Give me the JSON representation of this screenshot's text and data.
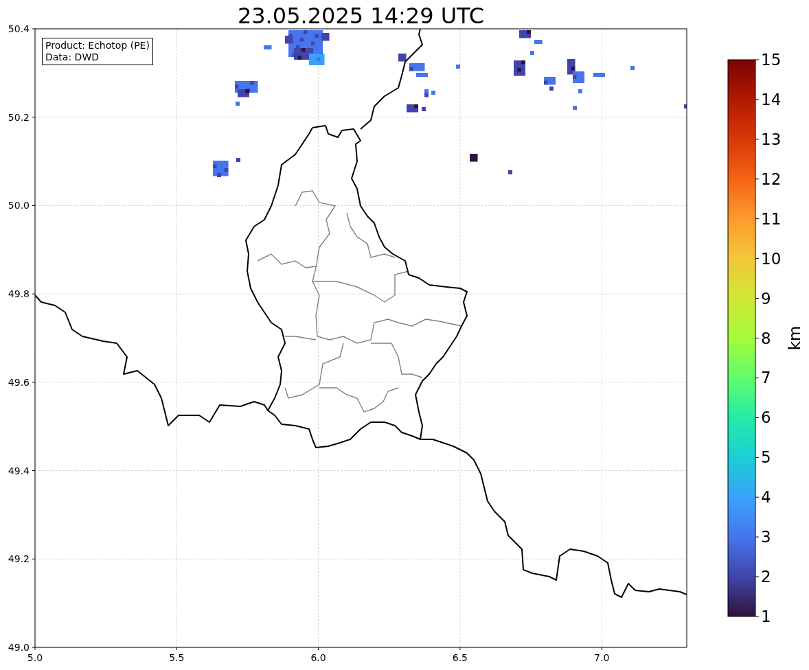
{
  "title": "23.05.2025 14:29 UTC",
  "annotation": [
    "Product: Echotop (PE)",
    "Data: DWD"
  ],
  "x_ticks": [
    "5.0",
    "5.5",
    "6.0",
    "6.5",
    "7.0"
  ],
  "y_ticks": [
    "50.4",
    "50.2",
    "50.0",
    "49.8",
    "49.6",
    "49.4",
    "49.2",
    "49.0"
  ],
  "colorbar": {
    "label": "km",
    "ticks": [
      "15",
      "14",
      "13",
      "12",
      "11",
      "10",
      "9",
      "8",
      "7",
      "6",
      "5",
      "4",
      "3",
      "2",
      "1"
    ]
  }
}
